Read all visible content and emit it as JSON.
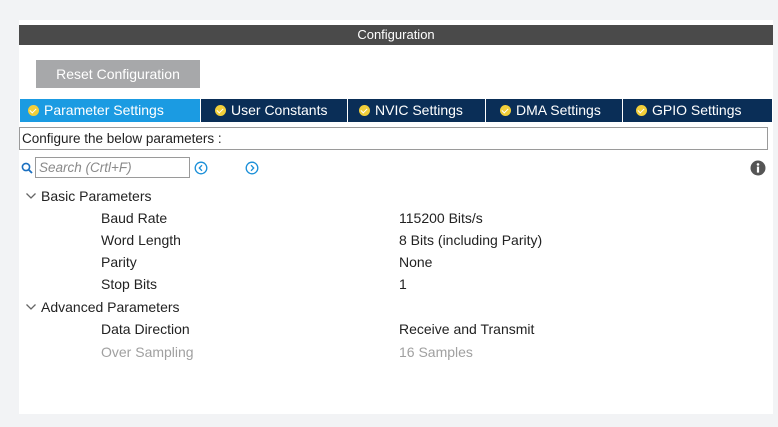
{
  "window": {
    "title": "Configuration"
  },
  "toolbar": {
    "reset_label": "Reset Configuration"
  },
  "tabs": [
    {
      "label": "Parameter Settings",
      "active": true
    },
    {
      "label": "User Constants",
      "active": false
    },
    {
      "label": "NVIC Settings",
      "active": false
    },
    {
      "label": "DMA Settings",
      "active": false
    },
    {
      "label": "GPIO Settings",
      "active": false
    }
  ],
  "hint": "Configure the below parameters :",
  "search": {
    "placeholder": "Search (Crtl+F)"
  },
  "groups": [
    {
      "label": "Basic Parameters",
      "params": [
        {
          "name": "Baud Rate",
          "value": "115200 Bits/s"
        },
        {
          "name": "Word Length",
          "value": "8 Bits (including Parity)"
        },
        {
          "name": "Parity",
          "value": "None"
        },
        {
          "name": "Stop Bits",
          "value": "1"
        }
      ]
    },
    {
      "label": "Advanced Parameters",
      "params": [
        {
          "name": "Data Direction",
          "value": "Receive and Transmit"
        },
        {
          "name": "Over Sampling",
          "value": "16 Samples",
          "disabled": true
        }
      ]
    }
  ],
  "colors": {
    "title_bar": "#4a4a4a",
    "tab_bar": "#0a2e57",
    "tab_active": "#1b9be2",
    "check": "#f2cf3a",
    "nav_icon": "#1a8fd8"
  }
}
